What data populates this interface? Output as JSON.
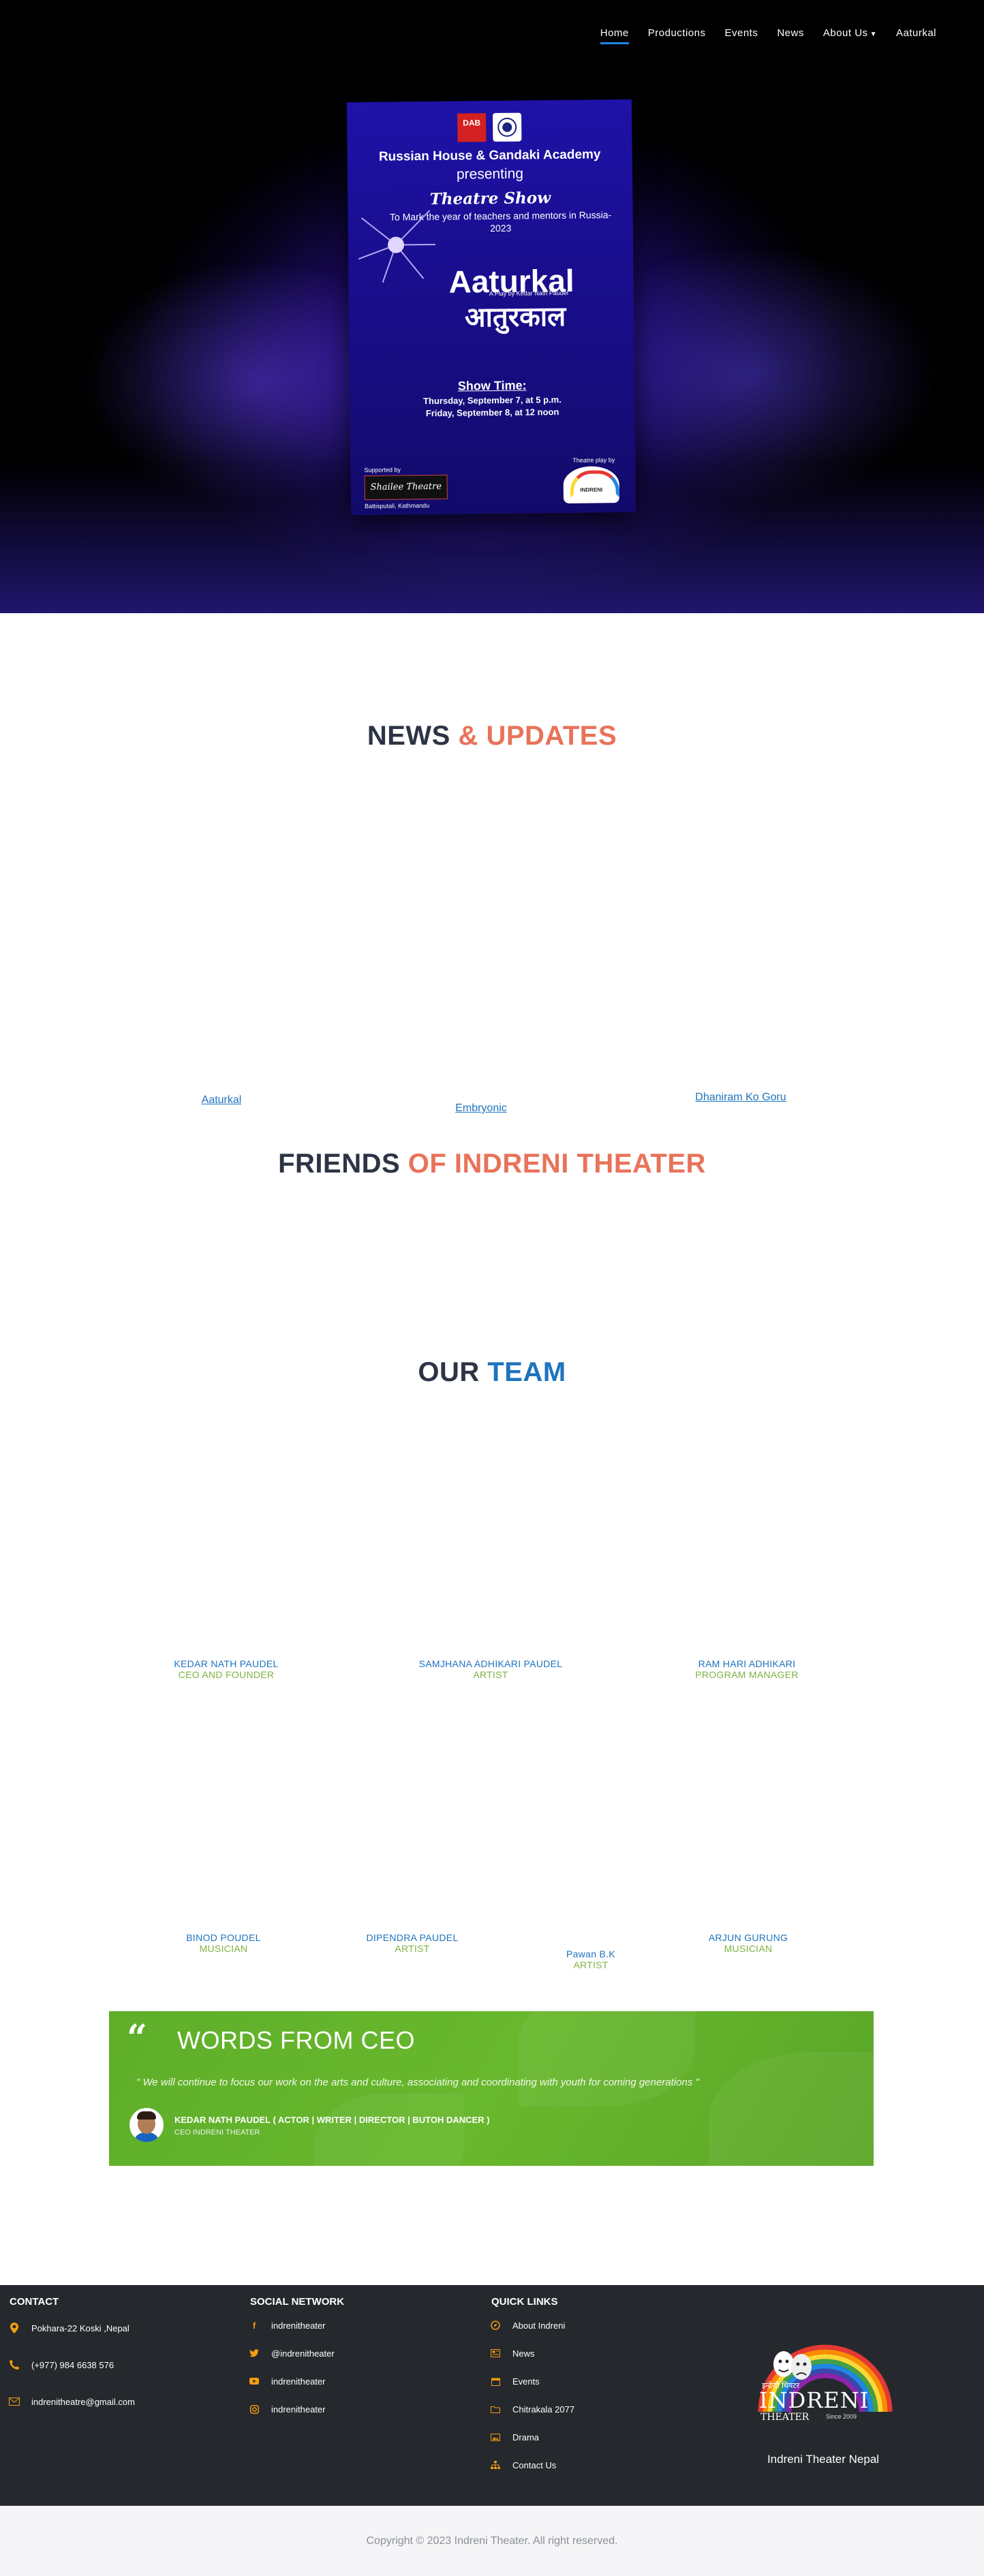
{
  "nav": {
    "items": [
      "Home",
      "Productions",
      "Events",
      "News",
      "About Us",
      "Aaturkal"
    ]
  },
  "poster": {
    "logo_left": "DAB",
    "line1": "Russian House  &  Gandaki Academy",
    "line2": "presenting",
    "show": "Theatre Show",
    "mark": "To Mark the year of  teachers and mentors in Russia-2023",
    "title": "Aaturkal",
    "nepali": "आतुरकाल",
    "byline": "A Play by Kedar Nath Paudel",
    "time_heading": "Show Time:",
    "date1": "Thursday, September 7, at 5 p.m.",
    "date2": "Friday, September 8, at 12 noon",
    "supported": "Supported by",
    "shailee": "Shailee Theatre",
    "location": "Battisputali, Kathmandu",
    "play_by": "Theatre play by",
    "indreni": "INDRENI"
  },
  "news": {
    "title_dark": "NEWS",
    "title_accent": " & UPDATES",
    "items": [
      "Aaturkal",
      "Embryonic",
      "Dhaniram Ko Goru"
    ]
  },
  "friends": {
    "title_dark": "FRIENDS",
    "title_accent": " OF INDRENI THEATER"
  },
  "team": {
    "title_dark": "OUR",
    "title_accent": " TEAM",
    "row1": [
      {
        "name": "KEDAR NATH PAUDEL",
        "role": "CEO AND FOUNDER"
      },
      {
        "name": "SAMJHANA ADHIKARI PAUDEL",
        "role": "ARTIST"
      },
      {
        "name": "RAM HARI ADHIKARI",
        "role": "PROGRAM MANAGER"
      }
    ],
    "row2": [
      {
        "name": "BINOD POUDEL",
        "role": "MUSICIAN"
      },
      {
        "name": "DIPENDRA PAUDEL",
        "role": "ARTIST"
      },
      {
        "name": "Pawan B.K",
        "role": "ARTIST"
      },
      {
        "name": "ARJUN GURUNG",
        "role": "MUSICIAN"
      }
    ]
  },
  "ceo": {
    "title": "WORDS FROM CEO",
    "quote": "\" We will continue to focus our work on the arts and culture, associating and coordinating with youth for coming generations \"",
    "name": "KEDAR NATH PAUDEL ( ACTOR | WRITER | DIRECTOR | BUTOH DANCER )",
    "role": "CEO INDRENI THEATER"
  },
  "footer": {
    "contact": {
      "heading": "CONTACT",
      "address": "Pokhara-22 Koski ,Nepal",
      "phone": "(+977) 984 6638 576",
      "email": "indrenitheatre@gmail.com"
    },
    "social": {
      "heading": "SOCIAL NETWORK",
      "facebook": "indrenitheater",
      "twitter": "@indrenitheater",
      "youtube": "indrenitheater",
      "instagram": "indrenitheater"
    },
    "quick": {
      "heading": "QUICK LINKS",
      "links": [
        "About Indreni",
        "News",
        "Events",
        "Chitrakala 2077",
        "Drama",
        "Contact Us"
      ]
    },
    "brand": {
      "nepali": "इन्द्रेणी थियटर",
      "big": "INDRENI",
      "small": "THEATER",
      "since": "Since 2009",
      "name": "Indreni Theater Nepal"
    },
    "accent_color": "#f39c12"
  },
  "copyright": "Copyright © 2023 Indreni Theater. All right reserved."
}
